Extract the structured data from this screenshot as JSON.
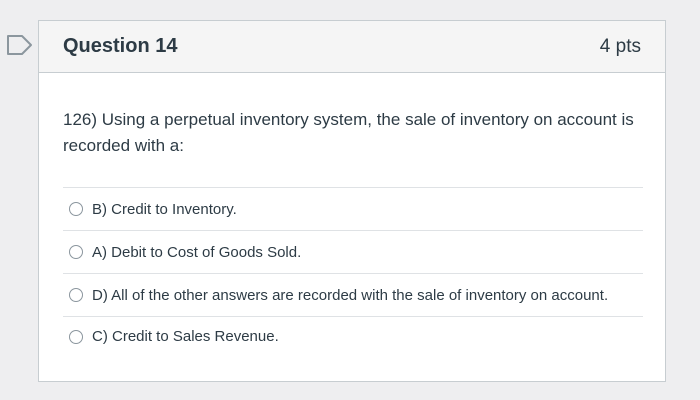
{
  "question": {
    "title": "Question 14",
    "points": "4 pts",
    "text": "126) Using a perpetual inventory system, the sale of inventory on account is recorded with a:",
    "flag_icon": "flag-outline-icon"
  },
  "answers": [
    {
      "label": "B) Credit to Inventory.",
      "selected": false
    },
    {
      "label": "A) Debit to Cost of Goods Sold.",
      "selected": false
    },
    {
      "label": "D) All of the other answers are recorded with the sale of inventory on account.",
      "selected": false
    },
    {
      "label": "C) Credit to Sales Revenue.",
      "selected": false
    }
  ],
  "colors": {
    "text": "#2d3b45",
    "header_bg": "#f5f5f5",
    "border": "#c7cdd1",
    "page_bg": "#eeeef0"
  }
}
